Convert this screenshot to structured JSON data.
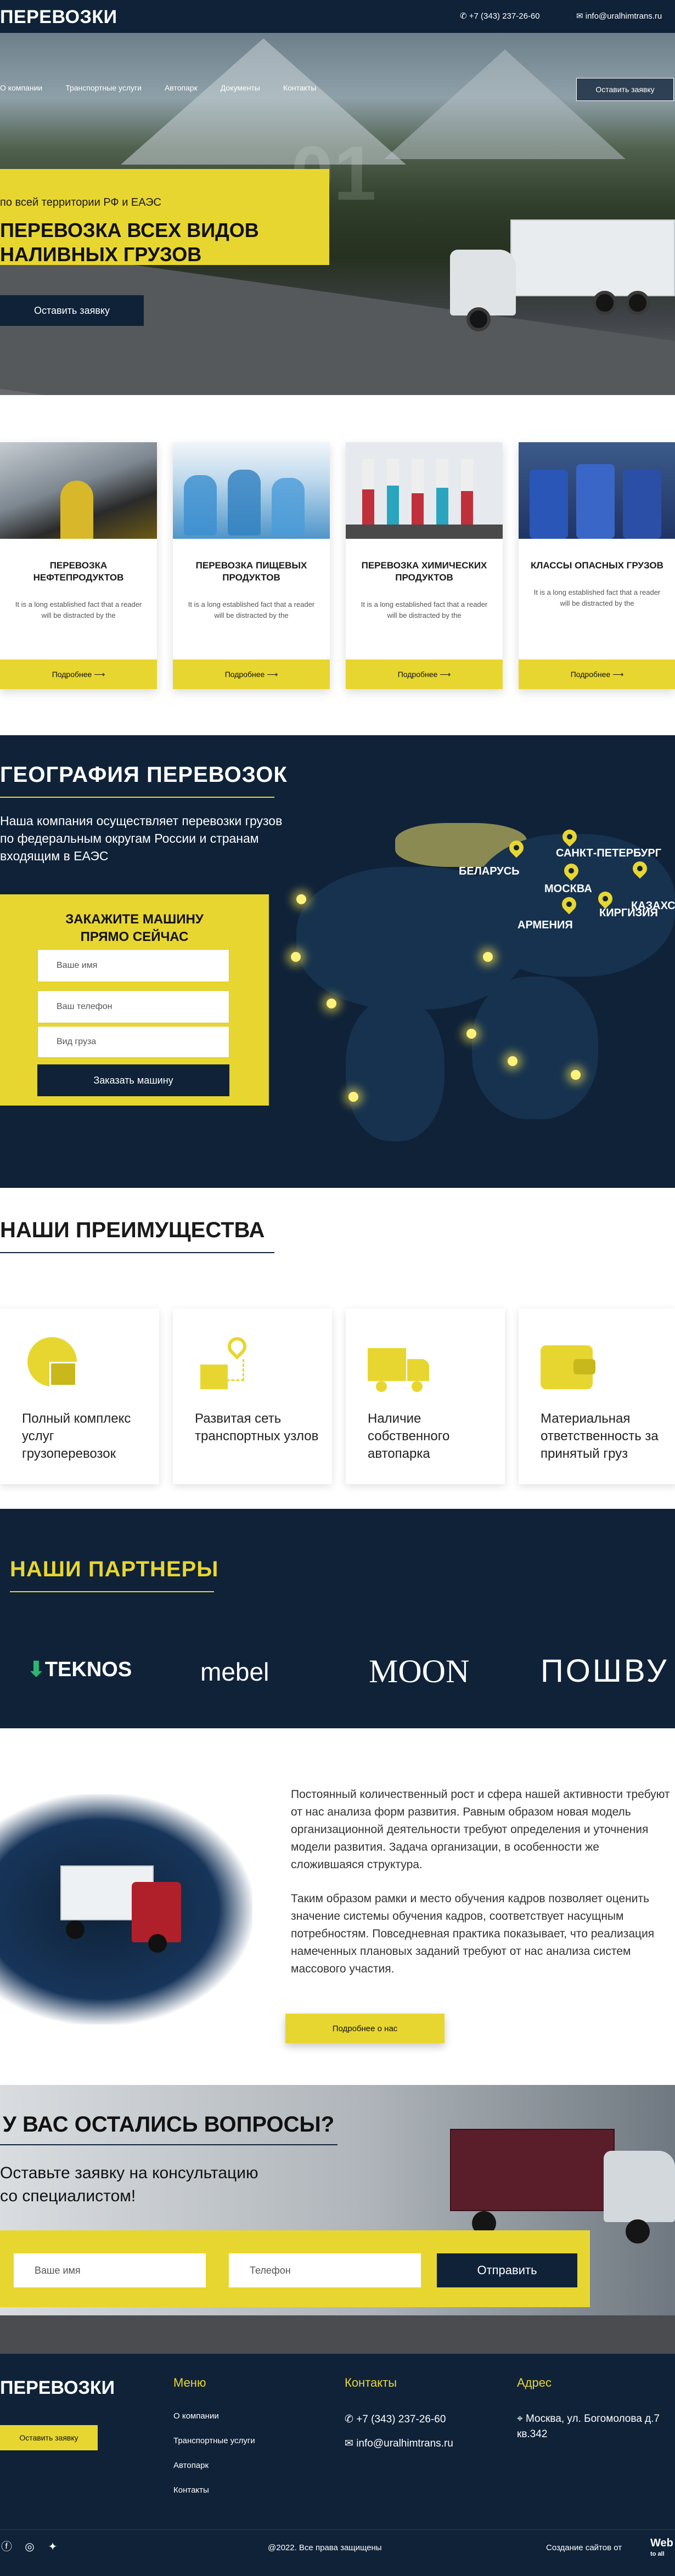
{
  "header": {
    "logo": "ПЕРЕВОЗКИ",
    "phone": "+7 (343) 237-26-60",
    "email": "info@uralhimtrans.ru",
    "nav": [
      "О компании",
      "Транспортные услуги",
      "Автопарк",
      "Документы",
      "Контакты"
    ],
    "call_button": "Оставить заявку"
  },
  "hero": {
    "slide_number": "01",
    "subtitle": "по всей территории РФ и ЕАЭС",
    "title_line1": "ПЕРЕВОЗКА ВСЕХ ВИДОВ",
    "title_line2": "НАЛИВНЫХ ГРУЗОВ",
    "button": "Оставить заявку",
    "slides_total": 3,
    "active_slide": 2
  },
  "services": [
    {
      "title": "ПЕРЕВОЗКА НЕФТЕПРОДУКТОВ",
      "text": "It is a long established fact that a reader will be distracted by the",
      "more": "Подробнее ⟶"
    },
    {
      "title": "ПЕРЕВОЗКА ПИЩЕВЫХ ПРОДУКТОВ",
      "text": "It is a long established fact that a reader will be distracted by the",
      "more": "Подробнее ⟶"
    },
    {
      "title": "ПЕРЕВОЗКА ХИМИЧЕСКИХ ПРОДУКТОВ",
      "text": "It is a long established fact that a reader will be distracted by the",
      "more": "Подробнее ⟶"
    },
    {
      "title": "КЛАССЫ ОПАСНЫХ ГРУЗОВ",
      "text": "It is a long established fact that a reader will be distracted by the",
      "more": "Подробнее ⟶"
    }
  ],
  "geography": {
    "title": "ГЕОГРАФИЯ ПЕРЕВОЗОК",
    "description": "Наша компания осуществляет перевозки грузов по федеральным округам России и странам входящим в ЕАЭС",
    "cities": [
      "БЕЛАРУСЬ",
      "САНКТ-ПЕТЕРБУРГ",
      "МОСКВА",
      "КАЗАХСТАН",
      "АРМЕНИЯ",
      "КИРГИЗИЯ"
    ],
    "order": {
      "title_line1": "ЗАКАЖИТЕ МАШИНУ",
      "title_line2": "ПРЯМО СЕЙЧАС",
      "name_placeholder": "Ваше имя",
      "phone_placeholder": "Ваш телефон",
      "cargo_placeholder": "Вид груза",
      "button": "Заказать машину"
    }
  },
  "advantages": {
    "title": "НАШИ ПРЕИМУЩЕСТВА",
    "items": [
      {
        "text": "Полный комплекс услуг грузоперевозок",
        "icon": "globe-box-icon"
      },
      {
        "text": "Развитая сеть транспортных узлов",
        "icon": "route-icon"
      },
      {
        "text": "Наличие собственного автопарка",
        "icon": "truck-icon"
      },
      {
        "text": "Материальная ответственность за принятый груз",
        "icon": "wallet-icon"
      }
    ]
  },
  "partners": {
    "title": "НАШИ ПАРТНЕРЫ",
    "logos": [
      "TEKNOS",
      "mebel",
      "MOON",
      "ПОШВУ"
    ]
  },
  "about": {
    "paragraph1": "Постоянный количественный рост и сфера нашей активности требуют от нас анализа форм развития. Равным образом новая модель организационной деятельности требуют определения и уточнения модели развития. Задача организации, в особенности же сложившаяся структура.",
    "paragraph2": "Таким образом рамки и место обучения кадров позволяет оценить значение системы обучения кадров, соответствует насущным потребностям. Повседневная практика показывает, что реализация намеченных плановых заданий требуют от нас анализа систем массового участия.",
    "button": "Подробнее о нас"
  },
  "questions": {
    "title": "У ВАС ОСТАЛИСЬ ВОПРОСЫ?",
    "subtitle_line1": "Оставьте заявку на консультацию",
    "subtitle_line2": "со специалистом!",
    "name_placeholder": "Ваше имя",
    "phone_placeholder": "Телефон",
    "button": "Отправить"
  },
  "footer": {
    "logo": "ПЕРЕВОЗКИ",
    "button": "Оставить заявку",
    "menu_title": "Меню",
    "menu": [
      "О компании",
      "Транспортные услуги",
      "Автопарк",
      "Контакты"
    ],
    "contacts_title": "Контакты",
    "phone": "+7 (343) 237-26-60",
    "email": "info@uralhimtrans.ru",
    "address_title": "Адрес",
    "address": "Москва, ул. Богомолова д.7 кв.342",
    "copyright": "@2022. Все права защищены",
    "made_by": "Создание сайтов от",
    "studio_line1": "Web",
    "studio_line2": "to all"
  },
  "colors": {
    "navy": "#0f2238",
    "yellow": "#e8d630"
  }
}
